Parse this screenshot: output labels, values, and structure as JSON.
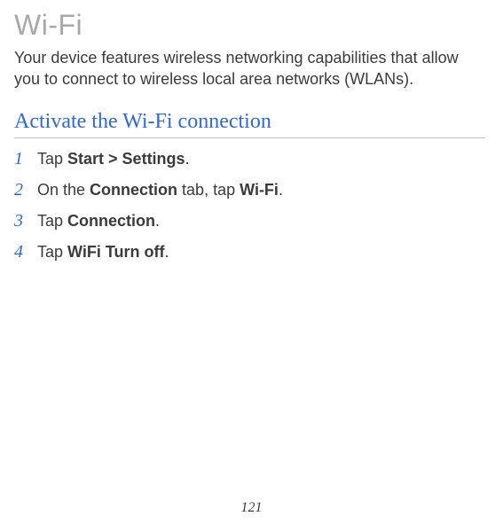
{
  "section": {
    "title": "Wi-Fi",
    "intro": "Your device features wireless networking capabilities that allow you to connect to wireless local area networks (WLANs)."
  },
  "subsection": {
    "title": "Activate the Wi-Fi connection"
  },
  "steps": [
    {
      "number": "1",
      "prefix": "Tap ",
      "bold": "Start > Settings",
      "suffix": "."
    },
    {
      "number": "2",
      "prefix": "On the ",
      "bold1": "Connection",
      "middle": " tab, tap ",
      "bold2": "Wi-Fi",
      "suffix": "."
    },
    {
      "number": "3",
      "prefix": "Tap ",
      "bold": "Connection",
      "suffix": "."
    },
    {
      "number": "4",
      "prefix": "Tap ",
      "bold": "WiFi Turn off",
      "suffix": "."
    }
  ],
  "page_number": "121"
}
